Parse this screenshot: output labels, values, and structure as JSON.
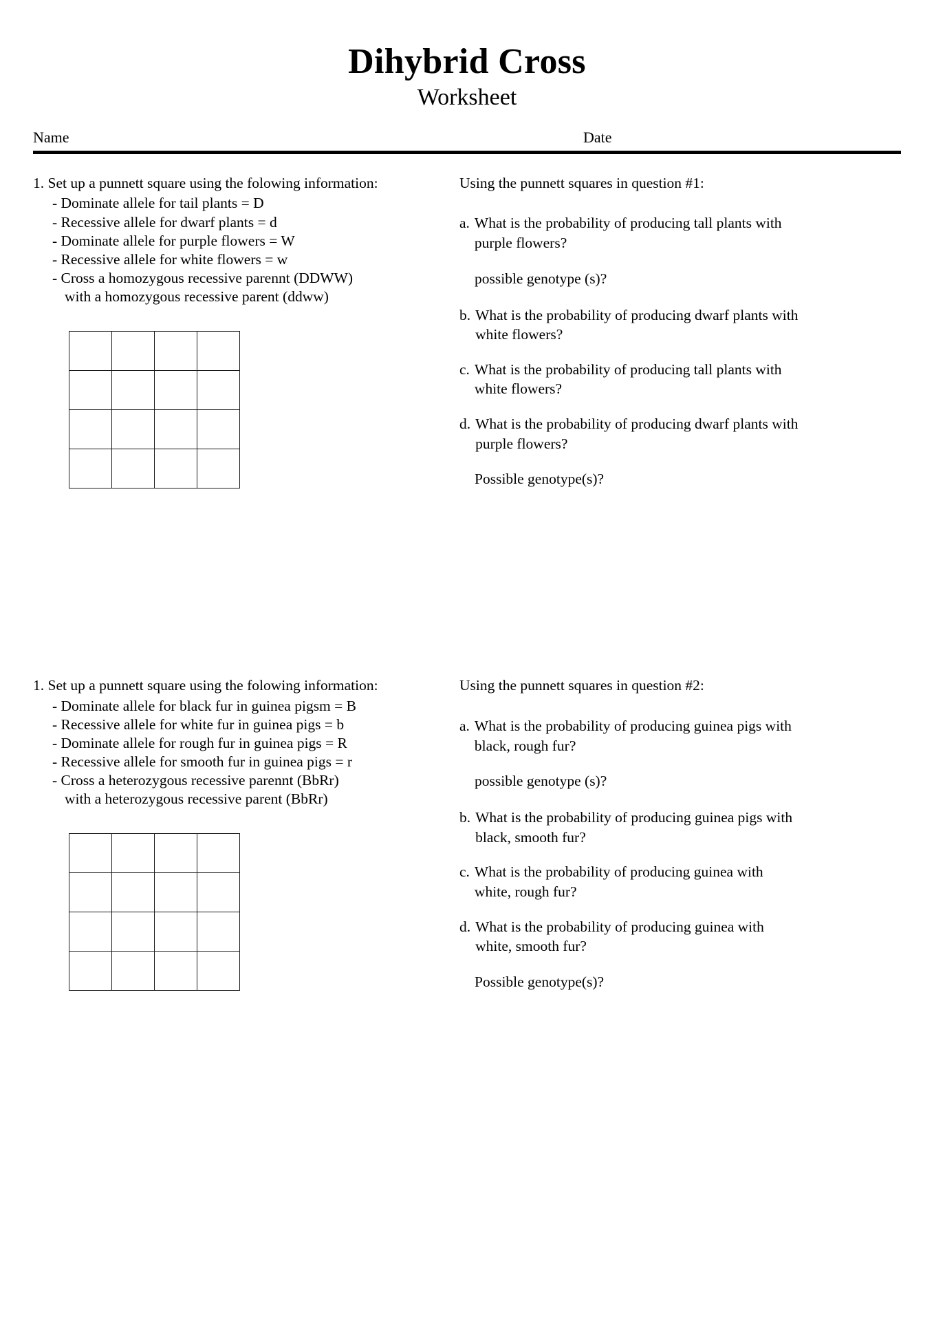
{
  "header": {
    "title": "Dihybrid Cross",
    "subtitle": "Worksheet",
    "name_label": "Name",
    "date_label": "Date"
  },
  "section1": {
    "left": {
      "heading": "1. Set up a punnett square using the folowing information:",
      "bullets": [
        "- Dominate allele for tail plants = D",
        "- Recessive allele for dwarf plants = d",
        "- Dominate allele for purple flowers = W",
        "- Recessive allele for white flowers = w",
        "- Cross a homozygous recessive parennt (DDWW)"
      ],
      "bullet_continuation": "with a homozygous recessive parent (ddww)",
      "grid": {
        "rows": 4,
        "cols": 4
      }
    },
    "right": {
      "intro": "Using the punnett squares in question #1:",
      "questions": [
        {
          "letter": "a.",
          "text": "What is the probability of producing tall plants with purple flowers?",
          "sub": "possible genotype (s)?"
        },
        {
          "letter": "b.",
          "text": "What is the probability of producing dwarf plants with white flowers?",
          "sub": ""
        },
        {
          "letter": "c.",
          "text": "What is the probability of producing tall plants with white flowers?",
          "sub": ""
        },
        {
          "letter": "d.",
          "text": "What is the probability of producing dwarf plants with purple flowers?",
          "sub": "Possible genotype(s)?"
        }
      ]
    }
  },
  "section2": {
    "left": {
      "heading": "1. Set up a punnett square using the folowing information:",
      "bullets": [
        "- Dominate allele for black fur in guinea pigsm = B",
        "- Recessive allele for white fur in guinea pigs = b",
        "- Dominate allele for rough fur in guinea pigs = R",
        "- Recessive allele for smooth fur in guinea pigs = r",
        "- Cross a heterozygous recessive parennt (BbRr)"
      ],
      "bullet_continuation": "with a heterozygous recessive parent (BbRr)",
      "grid": {
        "rows": 4,
        "cols": 4
      }
    },
    "right": {
      "intro": "Using the punnett squares in question #2:",
      "questions": [
        {
          "letter": "a.",
          "text": "What is the probability of producing guinea pigs with black, rough fur?",
          "sub": "possible genotype (s)?"
        },
        {
          "letter": "b.",
          "text": "What is the probability of producing guinea pigs with black, smooth fur?",
          "sub": ""
        },
        {
          "letter": "c.",
          "text": "What is the probability of producing guinea with white, rough fur?",
          "sub": ""
        },
        {
          "letter": "d.",
          "text": "What is the probability of producing guinea with white, smooth fur?",
          "sub": "Possible genotype(s)?"
        }
      ]
    }
  }
}
